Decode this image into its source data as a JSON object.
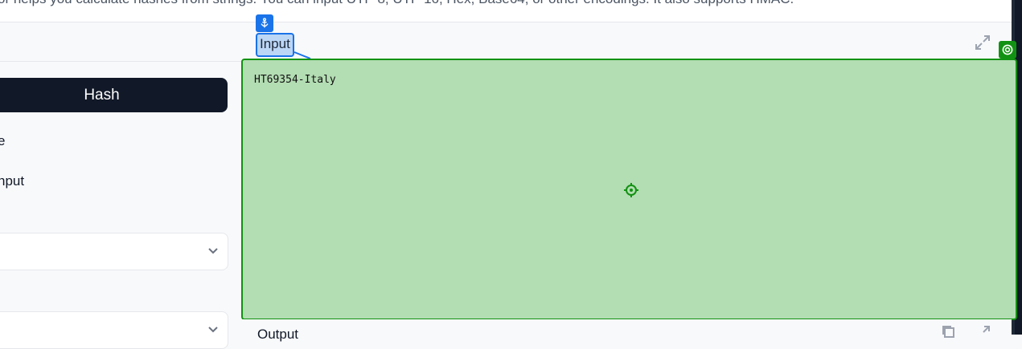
{
  "header": {
    "description": "or helps you calculate hashes from strings. You can input UTF-8, UTF-16, Hex, Base64, or other encodings. It also supports HMAC."
  },
  "sidebar": {
    "hash_button": "Hash",
    "option1": "e",
    "option2": "nput"
  },
  "input": {
    "label": "Input",
    "value": "HT69354-Italy"
  },
  "output": {
    "label": "Output"
  },
  "icons": {
    "anchor": "anchor-icon",
    "expand": "expand-icon",
    "target": "crosshair-target-icon",
    "badge": "target-circle-icon",
    "chevron": "chevron-down-icon",
    "copy": "copy-icon"
  },
  "colors": {
    "highlight_green": "#b3ddb3",
    "highlight_border": "#129212",
    "accent_blue": "#1a73e8",
    "dark_button": "#111827"
  }
}
